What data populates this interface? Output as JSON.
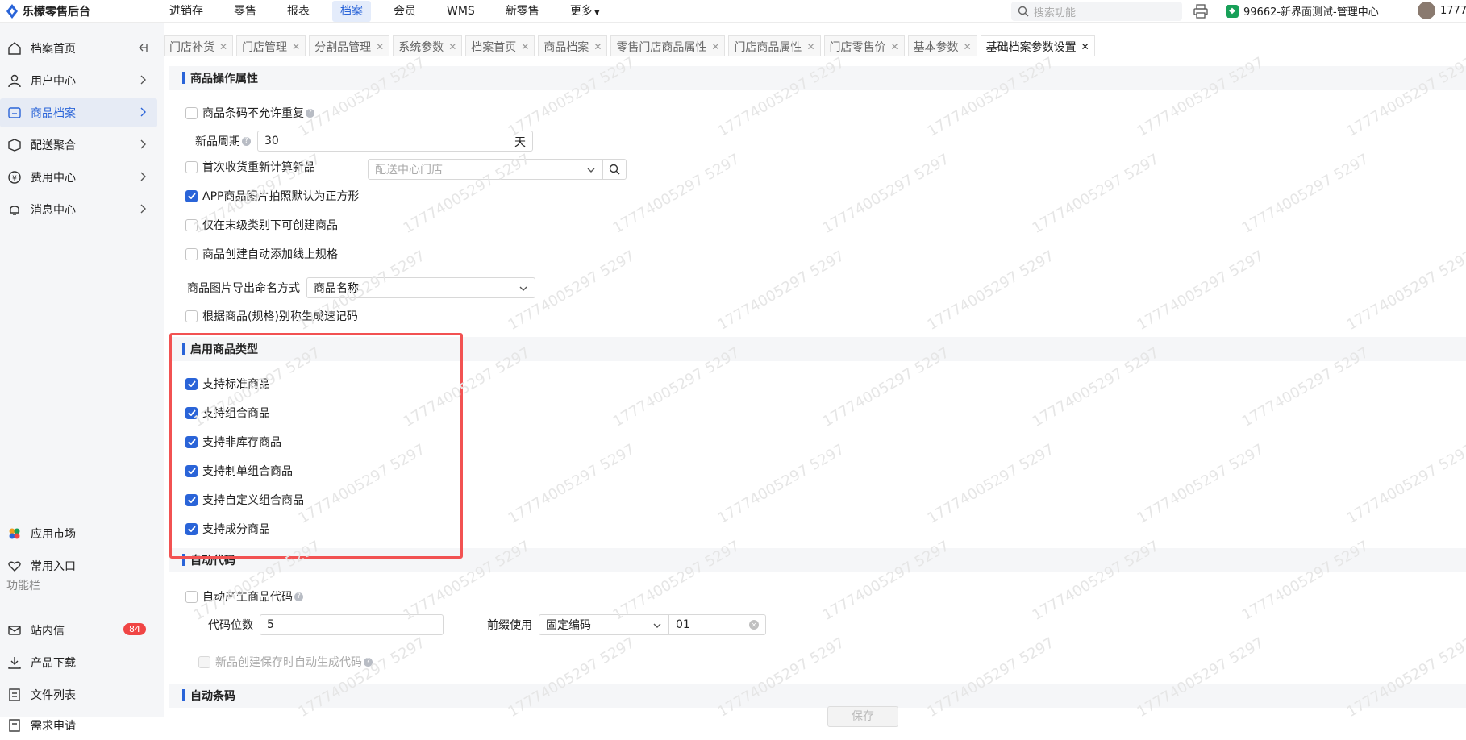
{
  "app": {
    "title": "乐檬零售后台"
  },
  "topnav": {
    "items": [
      "进销存",
      "零售",
      "报表",
      "档案",
      "会员",
      "WMS",
      "新零售",
      "更多"
    ],
    "active": "档案"
  },
  "search": {
    "placeholder": "搜索功能"
  },
  "store": {
    "name": "99662-新界面测试-管理中心"
  },
  "user": {
    "name": "1777"
  },
  "sidebar": {
    "items": [
      {
        "label": "档案首页",
        "icon": "home-icon"
      },
      {
        "label": "用户中心",
        "icon": "user-icon"
      },
      {
        "label": "商品档案",
        "icon": "product-icon"
      },
      {
        "label": "配送聚合",
        "icon": "delivery-icon"
      },
      {
        "label": "费用中心",
        "icon": "money-icon"
      },
      {
        "label": "消息中心",
        "icon": "bell-icon"
      }
    ],
    "bottom": [
      {
        "label": "应用市场",
        "icon": "app-market-icon"
      },
      {
        "label": "常用入口",
        "icon": "heart-icon"
      }
    ],
    "section_label": "功能栏",
    "tools": [
      {
        "label": "站内信",
        "icon": "mail-icon",
        "badge": "84"
      },
      {
        "label": "产品下载",
        "icon": "download-icon"
      },
      {
        "label": "文件列表",
        "icon": "file-list-icon"
      },
      {
        "label": "需求申请",
        "icon": "request-icon"
      }
    ]
  },
  "tabs": [
    "门店补货",
    "门店管理",
    "分割品管理",
    "系统参数",
    "档案首页",
    "商品档案",
    "零售门店商品属性",
    "门店商品属性",
    "门店零售价",
    "基本参数",
    "基础档案参数设置"
  ],
  "section1": {
    "title": "商品操作属性",
    "barcode_unique": "商品条码不允许重复",
    "new_period_label": "新品周期",
    "new_period_value": "30",
    "new_period_unit": "天",
    "first_receive": "首次收货重新计算新品",
    "center_store_placeholder": "配送中心门店",
    "app_photo_square": "APP商品图片拍照默认为正方形",
    "leaf_only": "仅在末级类别下可创建商品",
    "auto_online_spec": "商品创建自动添加线上规格",
    "image_export_label": "商品图片导出命名方式",
    "image_export_value": "商品名称",
    "quick_code": "根据商品(规格)别称生成速记码"
  },
  "section2": {
    "title": "启用商品类型",
    "options": [
      "支持标准商品",
      "支持组合商品",
      "支持非库存商品",
      "支持制单组合商品",
      "支持自定义组合商品",
      "支持成分商品"
    ]
  },
  "section3": {
    "title": "自动代码",
    "auto_code": "自动产生商品代码",
    "digits_label": "代码位数",
    "digits_value": "5",
    "prefix_label": "前缀使用",
    "prefix_type": "固定编码",
    "prefix_value": "01",
    "auto_on_save": "新品创建保存时自动生成代码"
  },
  "section4": {
    "title": "自动条码"
  },
  "save_label": "保存",
  "watermark_text": "17774005297 5297"
}
